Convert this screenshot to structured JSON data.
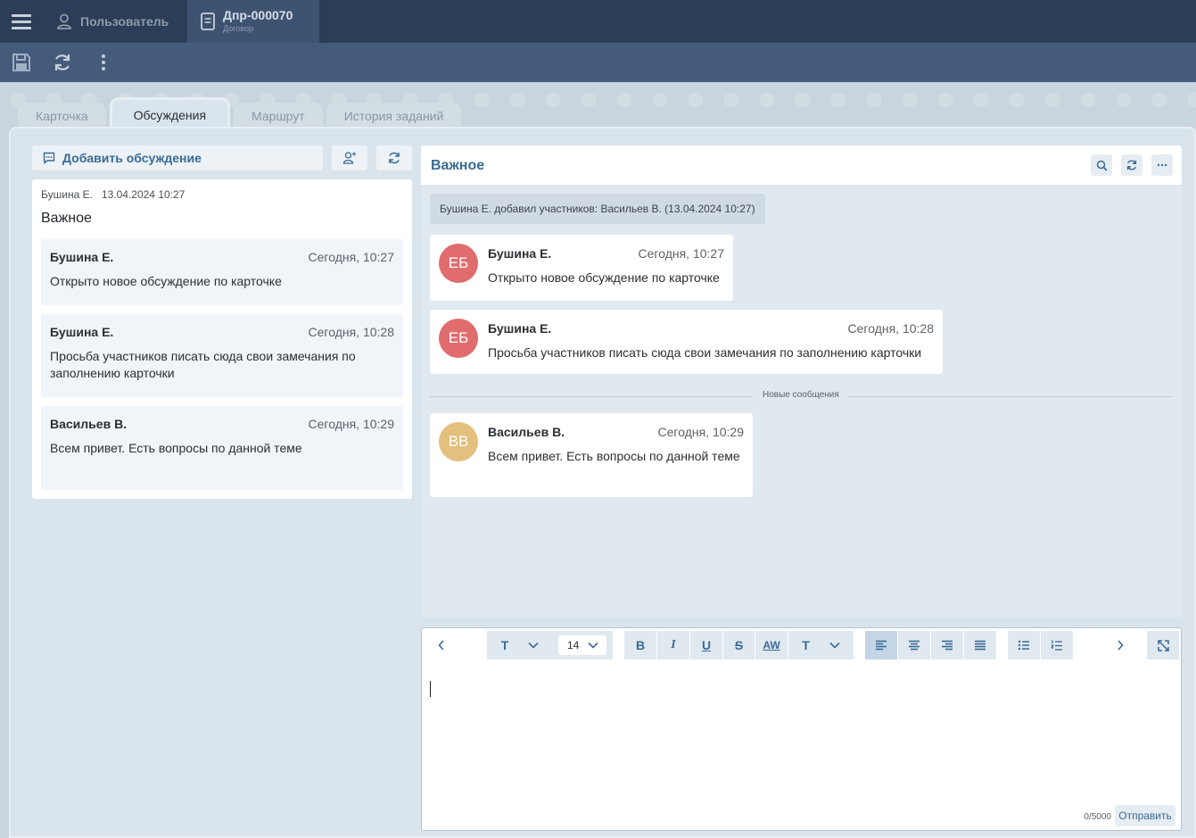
{
  "topbar": {
    "user_label": "Пользователь",
    "doc_title": "Дпр-000070",
    "doc_subtitle": "Договор"
  },
  "tabs": [
    {
      "label": "Карточка",
      "active": false
    },
    {
      "label": "Обсуждения",
      "active": true
    },
    {
      "label": "Маршрут",
      "active": false
    },
    {
      "label": "История заданий",
      "active": false
    }
  ],
  "left": {
    "add_discussion_label": "Добавить обсуждение",
    "discussion": {
      "author": "Бушина Е.",
      "date": "13.04.2024 10:27",
      "title": "Важное",
      "messages": [
        {
          "author": "Бушина Е.",
          "time": "Сегодня, 10:27",
          "text": "Открыто новое обсуждение по карточке"
        },
        {
          "author": "Бушина Е.",
          "time": "Сегодня, 10:28",
          "text": "Просьба участников писать сюда свои замечания по заполнению карточки"
        },
        {
          "author": "Васильев В.",
          "time": "Сегодня, 10:29",
          "text": "Всем привет. Есть вопросы по данной теме"
        }
      ]
    }
  },
  "chat": {
    "title": "Важное",
    "system_message": "Бушина Е. добавил участников: Васильев В. (13.04.2024 10:27)",
    "new_messages_label": "Новые сообщения",
    "messages": [
      {
        "initials": "ЕБ",
        "author": "Бушина Е.",
        "time": "Сегодня, 10:27",
        "text": "Открыто новое обсуждение по карточке",
        "avatar_color": "#e06c6e"
      },
      {
        "initials": "ЕБ",
        "author": "Бушина Е.",
        "time": "Сегодня, 10:28",
        "text": "Просьба участников писать сюда свои замечания по заполнению карточки",
        "avatar_color": "#e06c6e"
      },
      {
        "initials": "ВВ",
        "author": "Васильев В.",
        "time": "Сегодня, 10:29",
        "text": "Всем привет. Есть вопросы по данной теме",
        "avatar_color": "#e3c07e"
      }
    ]
  },
  "editor": {
    "font_size": "14",
    "counter": "0/5000",
    "send_label": "Отправить",
    "buttons": {
      "text_style": "T",
      "bold": "B",
      "italic": "I",
      "underline": "U",
      "strike": "S",
      "aw": "AW",
      "text_color": "T"
    }
  },
  "colors": {
    "accent": "#3a6a95",
    "topbar": "#2c3e57",
    "toolbar": "#445b7c"
  }
}
